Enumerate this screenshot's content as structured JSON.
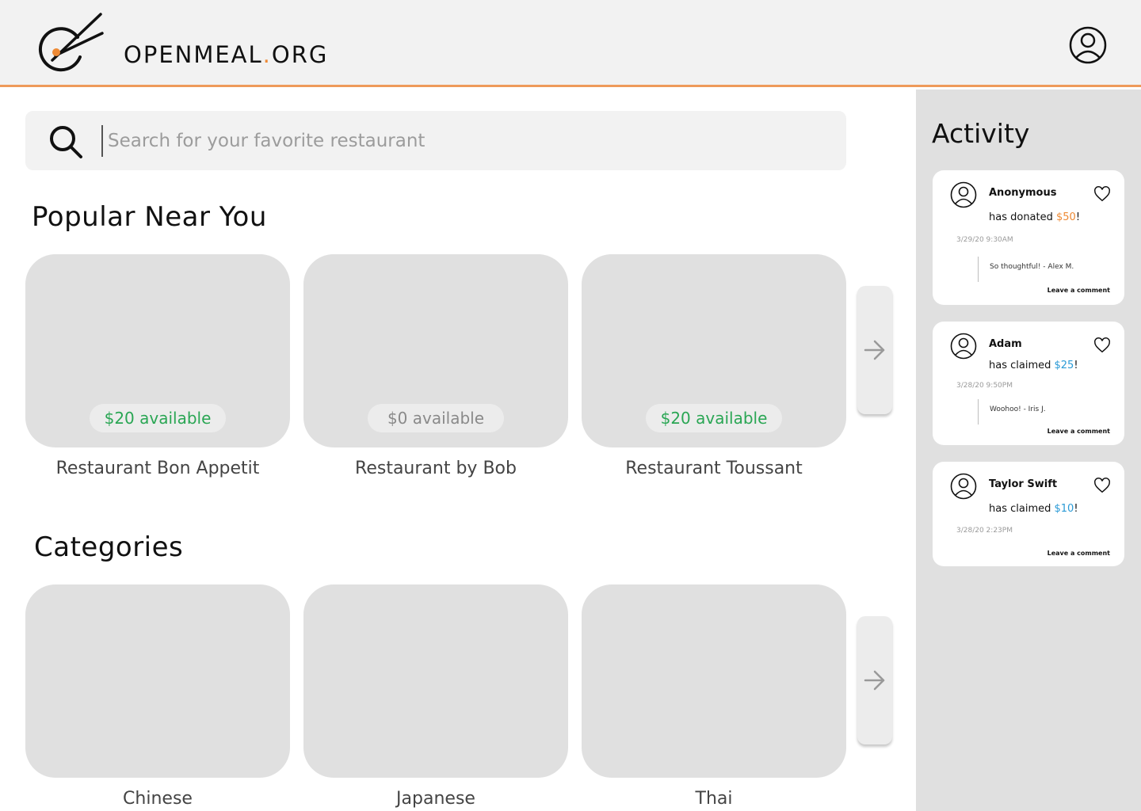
{
  "header": {
    "brand_main": "OPENMEAL",
    "brand_dot": ".",
    "brand_tld": "ORG",
    "logo_icon": "chopsticks-plate-icon",
    "profile_icon": "user-circle-icon"
  },
  "search": {
    "placeholder": "Search for your favorite restaurant",
    "icon": "search-icon"
  },
  "popular": {
    "title": "Popular Near You",
    "restaurants": [
      {
        "name": "Restaurant Bon Appetit",
        "availability": "$20 available"
      },
      {
        "name": "Restaurant by Bob",
        "availability": "$0 available"
      },
      {
        "name": "Restaurant Toussant",
        "availability": "$20 available"
      }
    ]
  },
  "categories": {
    "title": "Categories",
    "items": [
      {
        "name": "Chinese"
      },
      {
        "name": "Japanese"
      },
      {
        "name": "Thai"
      }
    ]
  },
  "activity": {
    "title": "Activity",
    "items": [
      {
        "user": "Anonymous",
        "action": "has donated ",
        "amount": "$50",
        "suffix": "!",
        "time": "3/29/20 9:30AM",
        "comment": "So thoughtful! - Alex M.",
        "leave_comment": "Leave a comment"
      },
      {
        "user": "Adam",
        "action": "has claimed ",
        "amount": "$25",
        "suffix": "!",
        "time": "3/28/20 9:50PM",
        "comment": "Woohoo! - Iris J.",
        "leave_comment": "Leave a comment"
      },
      {
        "user": "Taylor Swift",
        "action": "has claimed ",
        "amount": "$10",
        "suffix": "!",
        "time": "3/28/20 2:23PM",
        "leave_comment": "Leave a comment"
      }
    ]
  },
  "colors": {
    "accent_orange": "#ee8a35",
    "available_green": "#2aa654",
    "claimed_blue": "#2a9ad6"
  }
}
